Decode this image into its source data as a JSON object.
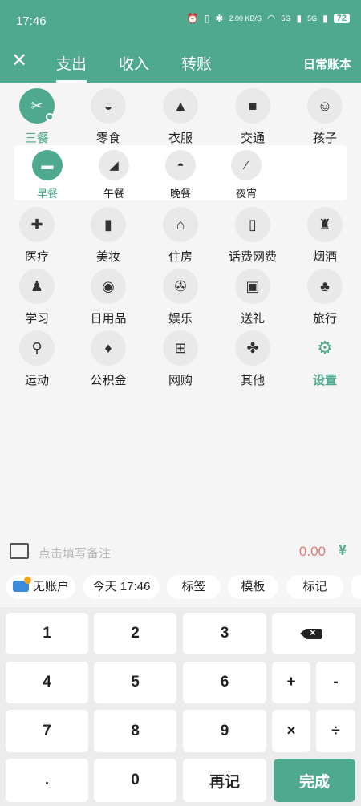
{
  "status_bar": {
    "time": "17:46",
    "net_speed": "2.00 KB/S",
    "signal_1": "5G",
    "signal_2": "5G",
    "battery": "72"
  },
  "header": {
    "tabs": [
      "支出",
      "收入",
      "转账"
    ],
    "active_tab": "支出",
    "book_name": "日常账本"
  },
  "categories": [
    {
      "label": "三餐",
      "icon": "fork-knife-icon",
      "glyph": "✂"
    },
    {
      "label": "零食",
      "icon": "cupcake-icon",
      "glyph": "◒"
    },
    {
      "label": "衣服",
      "icon": "shirt-icon",
      "glyph": "▲"
    },
    {
      "label": "交通",
      "icon": "bus-icon",
      "glyph": "■"
    },
    {
      "label": "孩子",
      "icon": "child-face-icon",
      "glyph": "☺"
    }
  ],
  "sub_categories": [
    {
      "label": "早餐",
      "icon": "breakfast-icon",
      "glyph": "▬"
    },
    {
      "label": "午餐",
      "icon": "lunch-icon",
      "glyph": "◢"
    },
    {
      "label": "晚餐",
      "icon": "dinner-icon",
      "glyph": "◓"
    },
    {
      "label": "夜宵",
      "icon": "late-snack-icon",
      "glyph": "⁄"
    }
  ],
  "categories_2": [
    {
      "label": "医疗",
      "icon": "medicine-icon",
      "glyph": "✚"
    },
    {
      "label": "美妆",
      "icon": "lipstick-icon",
      "glyph": "▮"
    },
    {
      "label": "住房",
      "icon": "house-icon",
      "glyph": "⌂"
    },
    {
      "label": "话费网费",
      "icon": "phone-bill-icon",
      "glyph": "▯"
    },
    {
      "label": "烟酒",
      "icon": "bottle-icon",
      "glyph": "♜"
    },
    {
      "label": "学习",
      "icon": "study-icon",
      "glyph": "♟"
    },
    {
      "label": "日用品",
      "icon": "tissue-icon",
      "glyph": "◉"
    },
    {
      "label": "娱乐",
      "icon": "film-reel-icon",
      "glyph": "✇"
    },
    {
      "label": "送礼",
      "icon": "gift-icon",
      "glyph": "▣"
    },
    {
      "label": "旅行",
      "icon": "palm-tree-icon",
      "glyph": "♣"
    },
    {
      "label": "运动",
      "icon": "bicycle-icon",
      "glyph": "⚲"
    },
    {
      "label": "公积金",
      "icon": "house-fund-icon",
      "glyph": "♦"
    },
    {
      "label": "网购",
      "icon": "cart-icon",
      "glyph": "⊞"
    },
    {
      "label": "其他",
      "icon": "four-dots-icon",
      "glyph": "✤"
    },
    {
      "label": "设置",
      "icon": "gear-icon",
      "glyph": "⚙"
    }
  ],
  "note": {
    "placeholder": "点击填写备注",
    "amount": "0.00",
    "currency": "¥"
  },
  "chips": [
    "无账户",
    "今天 17:46",
    "标签",
    "模板",
    "标记"
  ],
  "keypad": {
    "k1": "1",
    "k2": "2",
    "k3": "3",
    "k4": "4",
    "k5": "5",
    "k6": "6",
    "plus": "+",
    "minus": "-",
    "k7": "7",
    "k8": "8",
    "k9": "9",
    "times": "×",
    "divide": "÷",
    "dot": ".",
    "k0": "0",
    "again": "再记",
    "done": "完成"
  }
}
